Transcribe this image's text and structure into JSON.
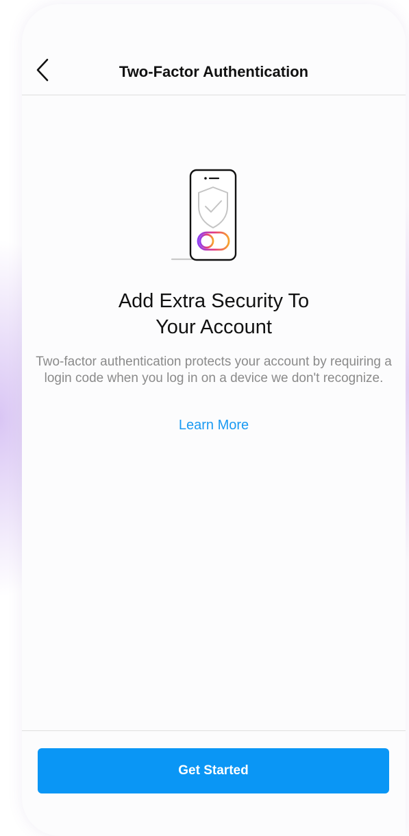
{
  "header": {
    "title": "Two-Factor Authentication",
    "back_icon": "chevron-left-icon"
  },
  "illustration": {
    "icon": "phone-shield-toggle-icon",
    "gradient_colors": [
      "#8e3cf0",
      "#e63c7a",
      "#f7a42c"
    ]
  },
  "content": {
    "headline_line1": "Add Extra Security To",
    "headline_line2": "Your Account",
    "description": "Two-factor authentication protects your account by requiring a login code when you log in on a device we don't recognize.",
    "learn_more": "Learn More"
  },
  "footer": {
    "cta_label": "Get Started"
  },
  "colors": {
    "accent": "#0a96f5",
    "link": "#1a9af2",
    "text_primary": "#111111",
    "text_secondary": "#8a8a8a"
  }
}
